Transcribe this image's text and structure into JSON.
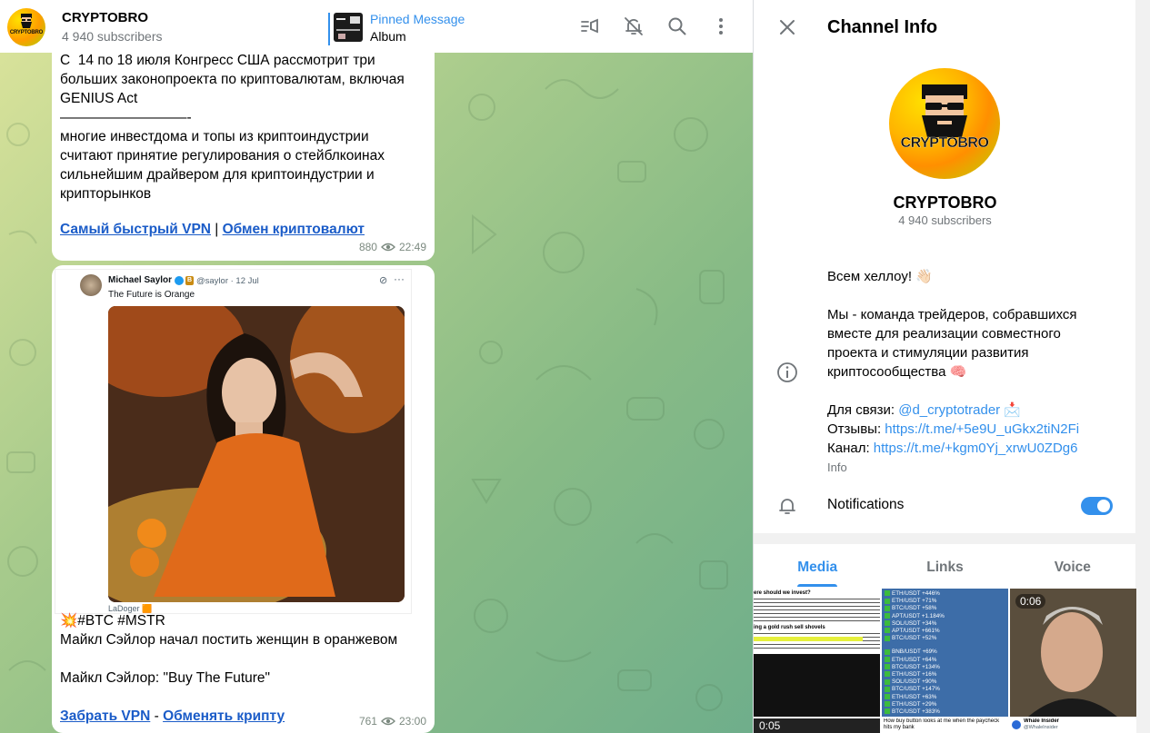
{
  "channel": {
    "title": "CRYPTOBRO",
    "subscribers": "4 940 subscribers",
    "logo_text": "CRYPTOBRO"
  },
  "pinned": {
    "label": "Pinned Message",
    "text": "Album"
  },
  "header_icons": [
    "live-stream-icon",
    "mute-bell-icon",
    "search-icon",
    "more-vertical-icon"
  ],
  "messages": [
    {
      "text": "С  14 по 18 июля Конгресс США рассмотрит три\nбольших законопроекта по криптовалютам, включая\nGENIUS Act\n—————————-\nмногие инвестдома и топы из криптоиндустрии\nсчитают принятие регулирования о стейблкоинах\nсильнейшим драйвером для криптоиндустрии и\nкрипторынков",
      "link1": "Самый быстрый VPN",
      "separator": " | ",
      "link2": "Обмен криптовалют",
      "views": "880",
      "time": "22:49"
    },
    {
      "tweet": {
        "author": "Michael Saylor",
        "handle": "@saylor · 12 Jul",
        "text": "The Future is Orange",
        "footer": "LaDoger 🟧"
      },
      "hashtags": "💥#BTC #MSTR",
      "line1": "Майкл Сэйлор начал постить женщин в оранжевом",
      "line2": "Майкл Сэйлор: \"Buy The Future\"",
      "link1": "Забрать VPN",
      "separator": " - ",
      "link2": "Обменять крипту",
      "views": "761",
      "time": "23:00"
    }
  ],
  "info_panel": {
    "title": "Channel Info",
    "name": "CRYPTOBRO",
    "subscribers": "4 940 subscribers",
    "about_greeting": "Всем хеллоу! 👋🏻",
    "about_body": "Мы - команда трейдеров, собравшихся\nвместе для реализации совместного\nпроекта и стимуляции развития\nкриптосообщества 🧠",
    "contact_label": "Для связи: ",
    "contact_handle": "@d_cryptotrader",
    "contact_emoji": " 📩",
    "reviews_label": "Отзывы: ",
    "reviews_link": "https://t.me/+5e9U_uGkx2tiN2Fi",
    "channel_label": "Канал: ",
    "channel_link": "https://t.me/+kgm0Yj_xrwU0ZDg6",
    "info_caption": "Info",
    "notifications_label": "Notifications",
    "notifications_on": true,
    "tabs": [
      "Media",
      "Links",
      "Voice"
    ],
    "active_tab": "Media",
    "media": {
      "video1_duration": "0:06",
      "video2_duration": "0:05",
      "tile1_caption": "ere should we invest?",
      "tile1_subcaption": "ing a gold rush sell shovels",
      "tile2_lines": [
        "ETH/USDT +446%",
        "ETH/USDT +71%",
        "BTC/USDT +58%",
        "APT/USDT +1.184%",
        "SOL/USDT +34%",
        "APT/USDT +661%",
        "BTC/USDT +52%",
        "BNB/USDT +69%",
        "ETH/USDT +64%",
        "BTC/USDT +134%",
        "ETH/USDT +16%",
        "SOL/USDT +90%",
        "BTC/USDT +147%",
        "ETH/USDT +63%",
        "ETH/USDT +29%",
        "BTC/USDT +383%"
      ],
      "tile5_caption": "How buy button looks at me when the paycheck hits my bank",
      "tile6_caption": "Whale Insider",
      "tile6_handle": "@WhaleInsider"
    }
  },
  "colors": {
    "accent": "#3390ec",
    "link_dark": "#1b5cc8",
    "muted": "#707579"
  }
}
